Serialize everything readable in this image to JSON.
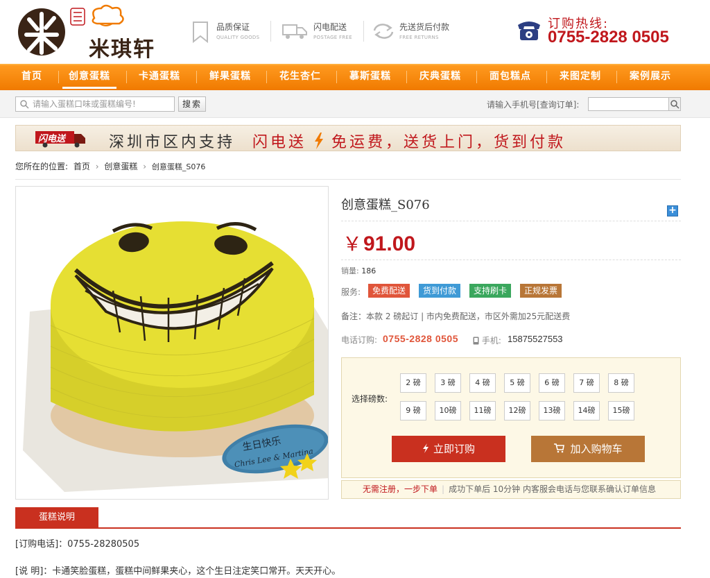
{
  "header": {
    "logo_name": "米琪轩",
    "features": [
      {
        "title": "品质保证",
        "sub": "QUALITY GOODS",
        "icon": "bookmark-icon"
      },
      {
        "title": "闪电配送",
        "sub": "POSTAGE FREE",
        "icon": "truck-icon"
      },
      {
        "title": "先送货后付款",
        "sub": "FREE RETURNS",
        "icon": "return-icon"
      }
    ],
    "hotline_label": "订购热线:",
    "hotline_number": "0755-2828 0505"
  },
  "nav": {
    "items": [
      "首页",
      "创意蛋糕",
      "卡通蛋糕",
      "鲜果蛋糕",
      "花生杏仁",
      "慕斯蛋糕",
      "庆典蛋糕",
      "面包糕点",
      "来图定制",
      "案例展示"
    ],
    "active_index": 1
  },
  "search": {
    "placeholder": "请输入蛋糕口味或蛋糕编号!",
    "button": "搜索",
    "order_label": "请输入手机号[查询订单]:"
  },
  "banner": {
    "badge": "闪电送",
    "text_part1": "深圳市区内支持",
    "text_part2": "闪电送",
    "text_part3": "免运费，送货上门，货到付款"
  },
  "breadcrumb": {
    "prefix": "您所在的位置:",
    "items": [
      "首页",
      "创意蛋糕",
      "创意蛋糕_S076"
    ]
  },
  "product": {
    "image_text": "生日快乐 Chris Lee & Martina",
    "title": "创意蛋糕_S076",
    "currency": "￥",
    "price": "91.00",
    "sales_label": "销量:",
    "sales_count": "186",
    "services_label": "服务:",
    "services": [
      {
        "label": "免费配送",
        "color": "#e0553a"
      },
      {
        "label": "货到付款",
        "color": "#3f9ad6"
      },
      {
        "label": "支持刷卡",
        "color": "#3aa75d"
      },
      {
        "label": "正规发票",
        "color": "#b87637"
      }
    ],
    "note": "备注：本款 2 磅起订 | 市内免费配送，市区外需加25元配送费",
    "phone_label": "电话订购:",
    "phone_number": "0755-2828 0505",
    "mobile_label": "手机:",
    "mobile_number": "15875527553"
  },
  "options": {
    "label": "选择磅数:",
    "weights": [
      "2 磅",
      "3 磅",
      "4 磅",
      "5 磅",
      "6 磅",
      "7 磅",
      "8 磅",
      "9 磅",
      "10磅",
      "11磅",
      "12磅",
      "13磅",
      "14磅",
      "15磅"
    ],
    "buy_label": "立即订购",
    "cart_label": "加入购物车"
  },
  "tip": {
    "red": "无需注册，一步下单",
    "rest": "成功下单后 10分钟 内客服会电话与您联系确认订单信息"
  },
  "description": {
    "tab": "蛋糕说明",
    "phone_line": "[订购电话]：0755-28280505",
    "desc_line": "[说 明]：卡通笑脸蛋糕，蛋糕中间鲜果夹心，这个生日注定笑口常开。天天开心。"
  },
  "colors": {
    "accent": "#c0171c",
    "nav": "#f07a00",
    "buy": "#c9301f",
    "cart": "#b87637"
  }
}
